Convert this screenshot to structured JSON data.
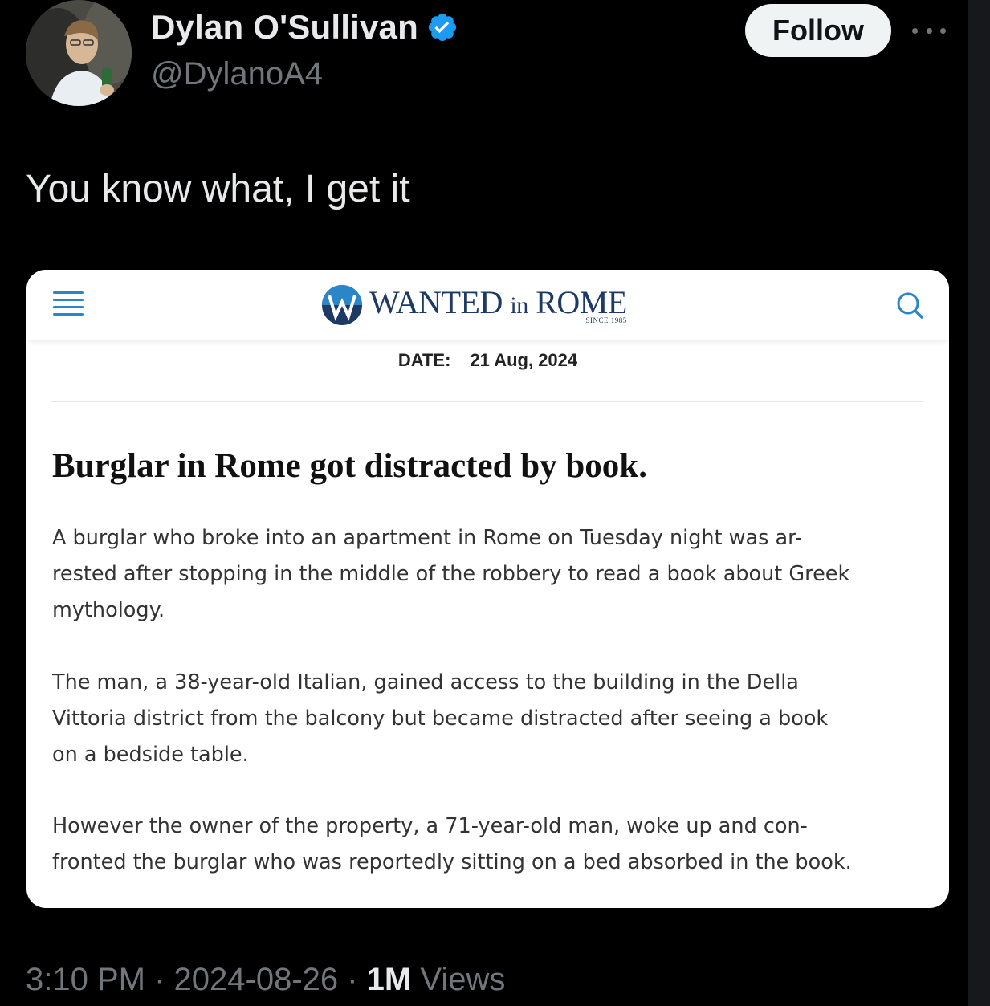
{
  "author": {
    "display_name": "Dylan O'Sullivan",
    "handle": "@DylanoA4",
    "verified_icon": "verified-badge-icon",
    "avatar": "profile-photo"
  },
  "actions": {
    "follow_label": "Follow",
    "more_icon": "more-options-icon"
  },
  "tweet": {
    "text": "You know what, I get it"
  },
  "card": {
    "site_name_main": "WANTED ",
    "site_name_in": "in",
    "site_name_end": " ROME",
    "since": "SINCE 1985",
    "date_label": "DATE:",
    "date_value": "21 Aug, 2024",
    "headline": "Burglar in Rome got distracted by book.",
    "paragraphs": [
      [
        "A burglar who broke into an apartment in Rome on Tuesday night was ar-",
        "rested after stopping in the middle of the robbery to read a book about Greek",
        "mythology."
      ],
      [
        "The man, a 38-year-old Italian, gained access to the building in the Della",
        "Vittoria district from the balcony but became distracted after seeing a book",
        "on a bedside table."
      ],
      [
        "However the owner of the property, a 71-year-old man, woke up and con-",
        "fronted the burglar who was reportedly sitting on a bed absorbed in the book."
      ]
    ]
  },
  "meta": {
    "time": "3:10 PM",
    "separator": " · ",
    "date": "2024-08-26",
    "views_count": "1M",
    "views_label": " Views"
  },
  "colors": {
    "background": "#000000",
    "text_primary": "#e7e9ea",
    "text_secondary": "#71767b",
    "verified_blue": "#1d9bf0",
    "site_blue": "#2a86c8",
    "site_navy": "#1c3a63"
  }
}
